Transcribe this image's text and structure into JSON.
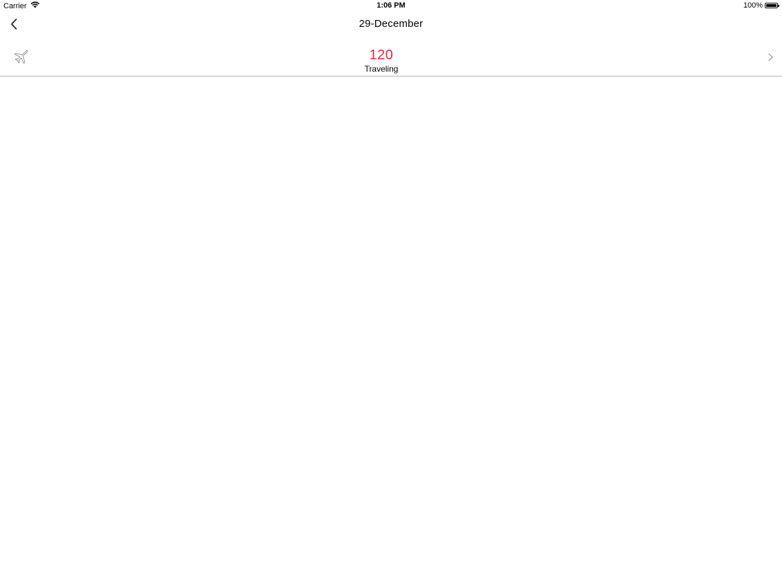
{
  "status_bar": {
    "carrier": "Carrier",
    "time": "1:06 PM",
    "battery_text": "100%",
    "battery_level": 1.0
  },
  "nav": {
    "title": "29-December",
    "back_icon": "chevron-left-icon"
  },
  "summary": {
    "icon": "airplane-icon",
    "count": "120",
    "label": "Traveling",
    "count_color": "#e8283a",
    "disclosure_icon": "chevron-right-icon"
  }
}
